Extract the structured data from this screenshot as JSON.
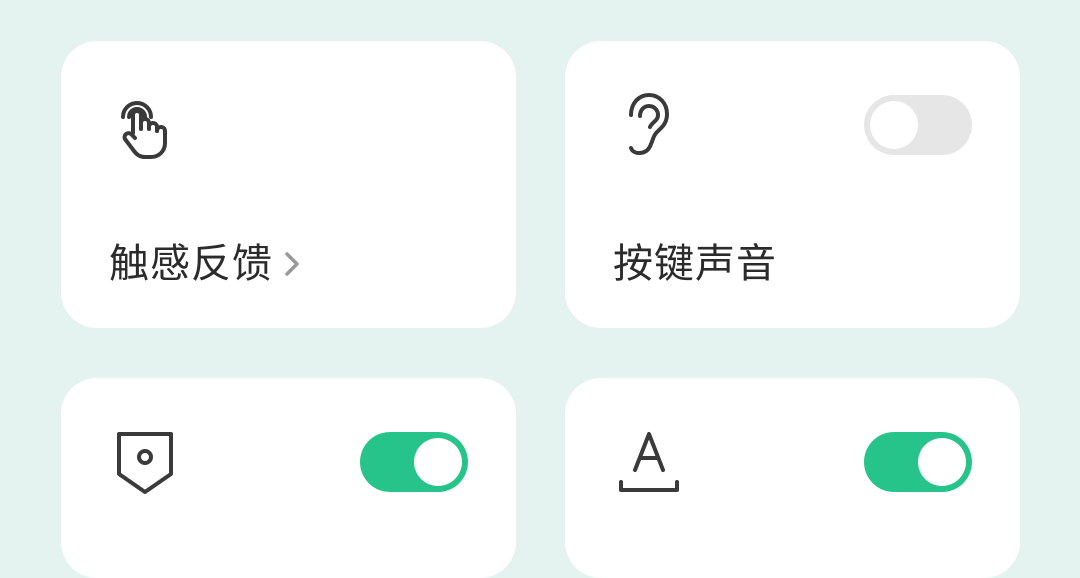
{
  "colors": {
    "background": "#e4f3ef",
    "card": "#ffffff",
    "accent_on": "#26c48a",
    "toggle_off": "#e6e6e6",
    "text": "#2b2b2b"
  },
  "cards": [
    {
      "icon": "tap-hand-icon",
      "label": "触感反馈",
      "has_chevron": true
    },
    {
      "icon": "ear-icon",
      "label": "按键声音",
      "toggle": "off"
    },
    {
      "icon": "shield-icon",
      "label": "",
      "toggle": "on"
    },
    {
      "icon": "font-underline-icon",
      "label": "",
      "toggle": "on"
    }
  ]
}
